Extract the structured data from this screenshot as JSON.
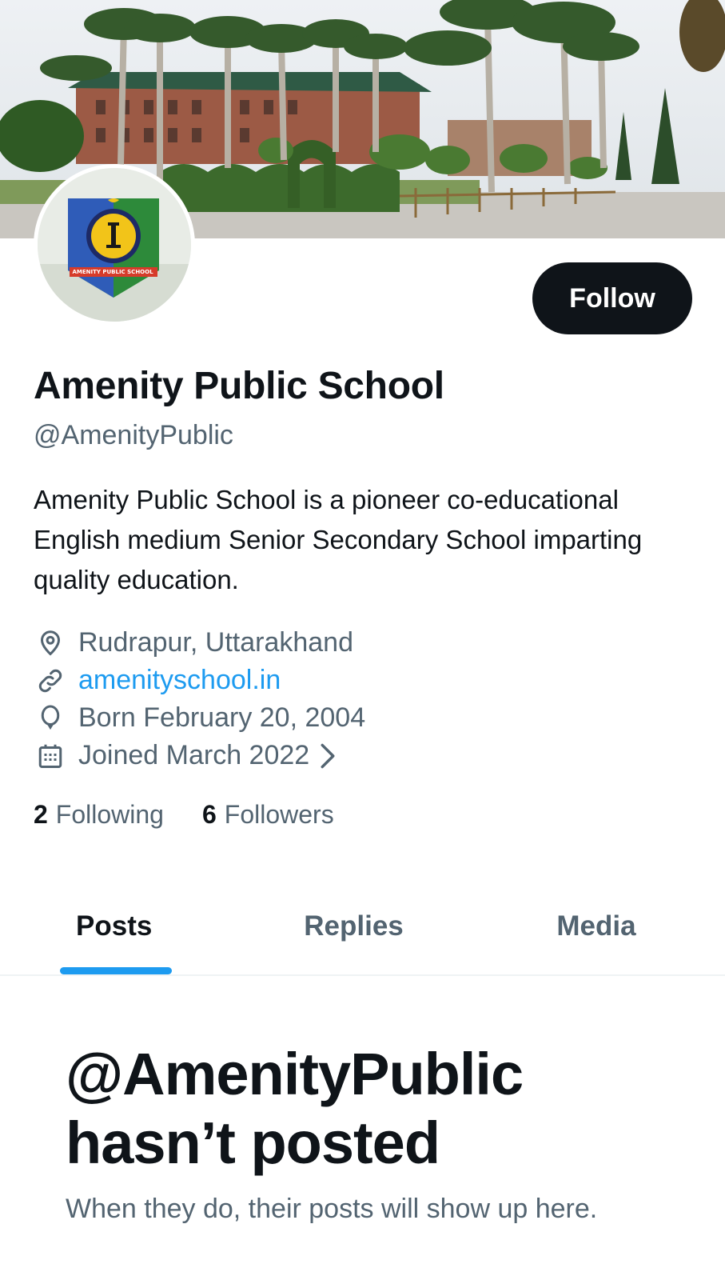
{
  "profile": {
    "name": "Amenity Public School",
    "handle": "@AmenityPublic",
    "bio": "Amenity Public School is a pioneer co-educational English medium Senior Secondary School imparting quality education.",
    "avatar_logo_text": "AMENITY PUBLIC SCHOOL",
    "location": "Rudrapur, Uttarakhand",
    "website": "amenityschool.in",
    "birthday": "Born February 20, 2004",
    "joined": "Joined March 2022"
  },
  "actions": {
    "follow_label": "Follow"
  },
  "stats": {
    "following_count": "2",
    "following_label": "Following",
    "followers_count": "6",
    "followers_label": "Followers"
  },
  "tabs": [
    {
      "label": "Posts",
      "active": true
    },
    {
      "label": "Replies",
      "active": false
    },
    {
      "label": "Media",
      "active": false
    }
  ],
  "empty_state": {
    "title": "@AmenityPublic hasn’t posted",
    "subtitle": "When they do, their posts will show up here."
  },
  "icons": {
    "location": "map-pin-icon",
    "website": "link-icon",
    "birthday": "balloon-icon",
    "joined": "calendar-icon",
    "joined_more": "chevron-right-icon"
  },
  "colors": {
    "primary_text": "#0f1419",
    "secondary_text": "#536471",
    "accent": "#1d9bf0",
    "follow_button": "#0f1419"
  }
}
